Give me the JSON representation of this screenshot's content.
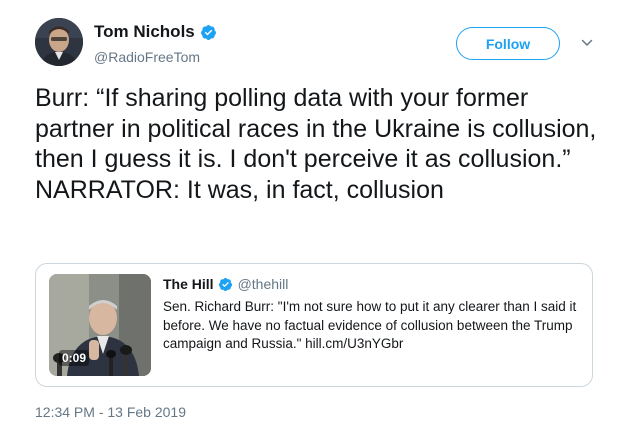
{
  "author": {
    "display_name": "Tom Nichols",
    "handle": "@RadioFreeTom",
    "verified": true
  },
  "follow_button": {
    "label": "Follow"
  },
  "tweet": {
    "text": "Burr: “If sharing polling data with your former partner in political races in the Ukraine is collusion, then I guess it is. I don't perceive it as collusion.”\nNARRATOR: It was, in fact, collusion"
  },
  "quoted_tweet": {
    "display_name": "The Hill",
    "handle": "@thehill",
    "verified": true,
    "text": "Sen. Richard Burr: \"I'm not sure how to put it any clearer than I said it before. We have no factual evidence of collusion between the Trump campaign and Russia.\" hill.cm/U3nYGbr",
    "video_duration": "0:09"
  },
  "timestamp": "12:34 PM - 13 Feb 2019",
  "colors": {
    "accent": "#1da1f2",
    "text_primary": "#14171a",
    "text_secondary": "#657786",
    "border": "#ccd6dd"
  },
  "icons": [
    "verified-badge-icon",
    "chevron-down-icon",
    "video-thumbnail"
  ]
}
